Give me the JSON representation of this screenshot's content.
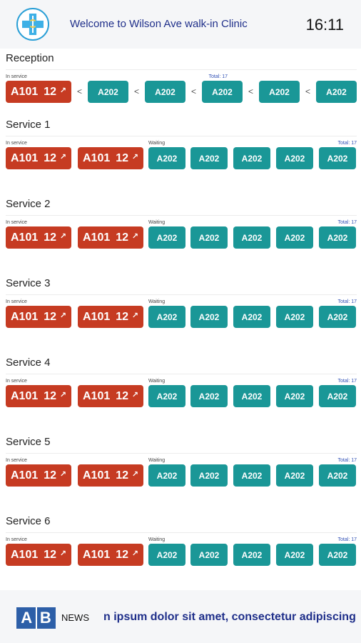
{
  "header": {
    "welcome": "Welcome to Wilson Ave walk-in Clinic",
    "time": "16:11"
  },
  "labels": {
    "in_service": "In service",
    "waiting": "Waiting",
    "total": "Total: 17"
  },
  "reception": {
    "title": "Reception",
    "in_service_ticket": {
      "code": "A101",
      "number": "12"
    },
    "queue": [
      "A202",
      "A202",
      "A202",
      "A202",
      "A202"
    ],
    "separator": "<"
  },
  "services": [
    {
      "title": "Service 1",
      "in_service": [
        {
          "code": "A101",
          "number": "12"
        },
        {
          "code": "A101",
          "number": "12"
        }
      ],
      "waiting": [
        "A202",
        "A202",
        "A202",
        "A202",
        "A202"
      ]
    },
    {
      "title": "Service 2",
      "in_service": [
        {
          "code": "A101",
          "number": "12"
        },
        {
          "code": "A101",
          "number": "12"
        }
      ],
      "waiting": [
        "A202",
        "A202",
        "A202",
        "A202",
        "A202"
      ]
    },
    {
      "title": "Service 3",
      "in_service": [
        {
          "code": "A101",
          "number": "12"
        },
        {
          "code": "A101",
          "number": "12"
        }
      ],
      "waiting": [
        "A202",
        "A202",
        "A202",
        "A202",
        "A202"
      ]
    },
    {
      "title": "Service 4",
      "in_service": [
        {
          "code": "A101",
          "number": "12"
        },
        {
          "code": "A101",
          "number": "12"
        }
      ],
      "waiting": [
        "A202",
        "A202",
        "A202",
        "A202",
        "A202"
      ]
    },
    {
      "title": "Service 5",
      "in_service": [
        {
          "code": "A101",
          "number": "12"
        },
        {
          "code": "A101",
          "number": "12"
        }
      ],
      "waiting": [
        "A202",
        "A202",
        "A202",
        "A202",
        "A202"
      ]
    },
    {
      "title": "Service 6",
      "in_service": [
        {
          "code": "A101",
          "number": "12"
        },
        {
          "code": "A101",
          "number": "12"
        }
      ],
      "waiting": [
        "A202",
        "A202",
        "A202",
        "A202",
        "A202"
      ]
    }
  ],
  "footer": {
    "logo_left": "A",
    "logo_right": "B",
    "news_label": "NEWS",
    "ticker": "n ipsum dolor sit amet, consectetur adipiscing"
  },
  "colors": {
    "in_service": "#c63b22",
    "waiting": "#1a9797",
    "brand_text": "#1f2f8a"
  },
  "icons": {
    "ticket_arrow": "↗"
  }
}
